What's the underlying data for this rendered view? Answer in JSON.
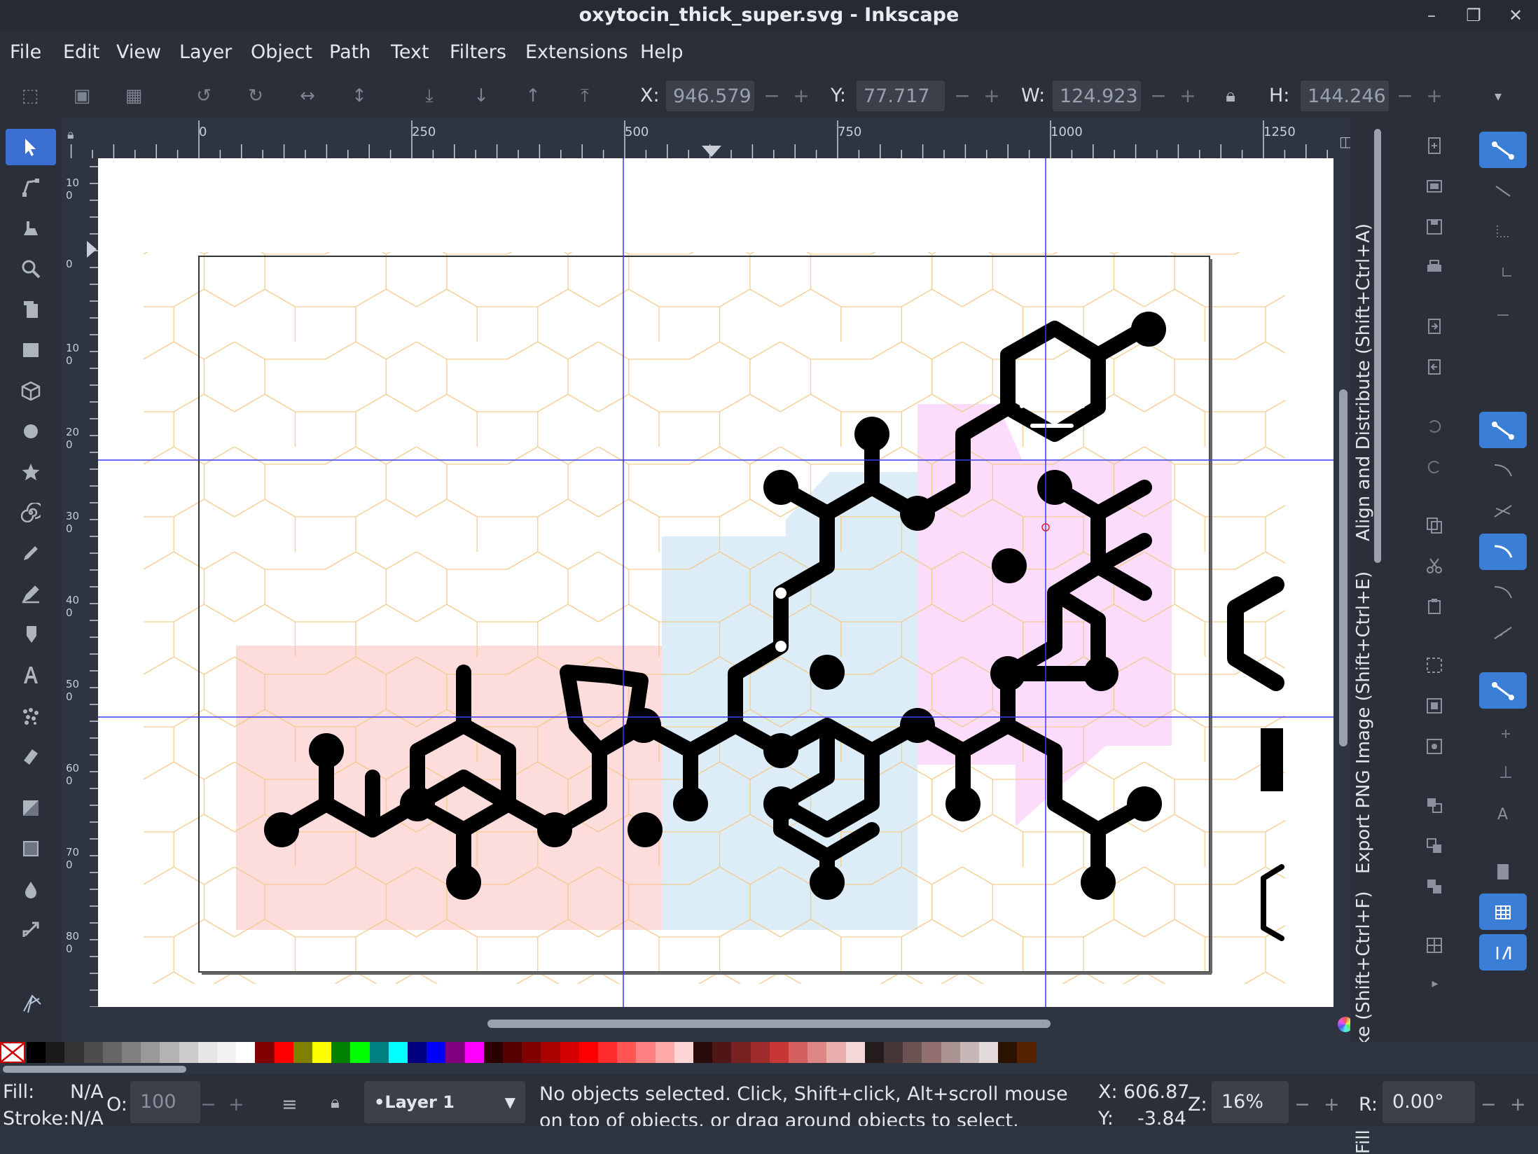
{
  "window": {
    "title": "oxytocin_thick_super.svg - Inkscape"
  },
  "menu": [
    "File",
    "Edit",
    "View",
    "Layer",
    "Object",
    "Path",
    "Text",
    "Filters",
    "Extensions",
    "Help"
  ],
  "controls": {
    "x_label": "X:",
    "x_value": "946.579",
    "y_label": "Y:",
    "y_value": "77.717",
    "w_label": "W:",
    "w_value": "124.923",
    "h_label": "H:",
    "h_value": "144.246",
    "minus": "−",
    "plus": "+"
  },
  "hruler_labels": [
    "0",
    "250",
    "500",
    "750",
    "1000",
    "1250"
  ],
  "vruler_labels": [
    "100",
    "0",
    "100",
    "200",
    "300",
    "400",
    "500",
    "600",
    "700",
    "800"
  ],
  "dock_tabs": {
    "align": "Align and Distribute (Shift+Ctrl+A)",
    "export": "Export PNG Image (Shift+Ctrl+E)",
    "fill": "Fill and Stroke (Shift+Ctrl+F)"
  },
  "status": {
    "fill_label": "Fill:",
    "fill_value": "N/A",
    "stroke_label": "Stroke:",
    "stroke_value": "N/A",
    "opacity_label": "O:",
    "opacity_value": "100",
    "layer": "•Layer 1",
    "message": "No objects selected. Click, Shift+click, Alt+scroll mouse on top of objects, or drag around objects to select.",
    "cursor_x_label": "X:",
    "cursor_x": "606.87",
    "cursor_y_label": "Y:",
    "cursor_y": "-3.84",
    "zoom_label": "Z:",
    "zoom": "16%",
    "rotation_label": "R:",
    "rotation": "0.00°"
  },
  "colors": {
    "accent": "#3b7ed8",
    "region_red": "#fddcdc",
    "region_blue": "#dcedf8",
    "region_magenta": "#fbdcfb",
    "hexgrid": "#f3c98a",
    "guide": "#3a3af0"
  },
  "palette": [
    "#000000",
    "#1a1a1a",
    "#333333",
    "#4d4d4d",
    "#666666",
    "#808080",
    "#999999",
    "#b3b3b3",
    "#cccccc",
    "#e6e6e6",
    "#f2f2f2",
    "#ffffff",
    "#800000",
    "#ff0000",
    "#808000",
    "#ffff00",
    "#008000",
    "#00ff00",
    "#008080",
    "#00ffff",
    "#000080",
    "#0000ff",
    "#800080",
    "#ff00ff",
    "#2b0000",
    "#550000",
    "#800000",
    "#aa0000",
    "#d40000",
    "#ff0000",
    "#ff2a2a",
    "#ff5555",
    "#ff8080",
    "#ffaaaa",
    "#ffd5d5",
    "#280b0b",
    "#501616",
    "#782121",
    "#a02c2c",
    "#c83737",
    "#d35f5f",
    "#de8787",
    "#e9afaf",
    "#f4d7d7",
    "#241c1c",
    "#483737",
    "#6c5353",
    "#916f6f",
    "#ac9393",
    "#c8b7b7",
    "#e3dbdb",
    "#2b1100",
    "#552200"
  ]
}
